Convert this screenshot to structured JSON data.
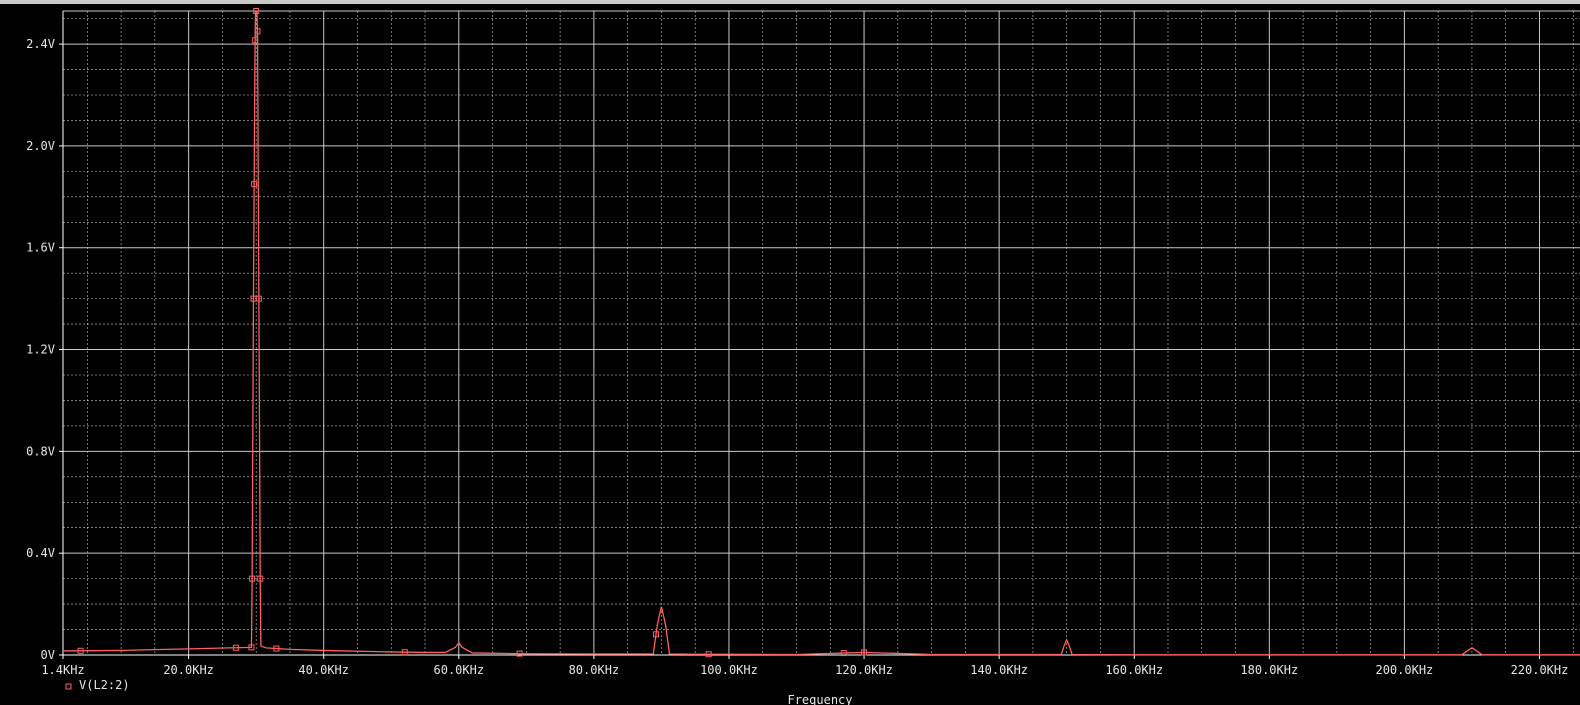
{
  "chart_data": {
    "type": "line",
    "title": "",
    "xlabel": "Frequency",
    "ylabel": "",
    "xlim": [
      1.4,
      226.0
    ],
    "ylim": [
      0,
      2.53
    ],
    "x_unit": "KHz",
    "grid": true,
    "grid_minor": true,
    "x_ticks": [
      1.4,
      20,
      40,
      60,
      80,
      100,
      120,
      140,
      160,
      180,
      200,
      220
    ],
    "x_tick_labels": [
      "1.4KHz",
      "20.0KHz",
      "40.0KHz",
      "60.0KHz",
      "80.0KHz",
      "100.0KHz",
      "120.0KHz",
      "140.0KHz",
      "160.0KHz",
      "180.0KHz",
      "200.0KHz",
      "220.0KHz"
    ],
    "y_ticks": [
      0,
      0.4,
      0.8,
      1.2,
      1.6,
      2.0,
      2.4
    ],
    "y_tick_labels": [
      "0V",
      "0.4V",
      "0.8V",
      "1.2V",
      "1.6V",
      "2.0V",
      "2.4V"
    ],
    "legend": {
      "placement": "bottom-left"
    },
    "series": [
      {
        "name": "V(L2:2)",
        "color": "#ff6060",
        "marker": "square",
        "x": [
          1.4,
          10,
          20,
          26,
          29.3,
          29.4,
          29.6,
          29.8,
          29.9,
          30.0,
          30.1,
          30.2,
          30.4,
          30.6,
          30.7,
          31.5,
          35,
          40,
          50,
          55,
          58,
          59.5,
          60,
          60.5,
          62,
          70,
          80,
          88.8,
          89.4,
          90,
          90.6,
          91.2,
          95,
          100,
          110,
          120,
          130,
          149.2,
          149.6,
          150,
          150.4,
          150.8,
          160,
          180,
          200,
          208.5,
          209.5,
          210,
          210.5,
          211.5,
          220,
          226
        ],
        "y": [
          0.016,
          0.018,
          0.024,
          0.028,
          0.03,
          0.3,
          1.4,
          2.3,
          2.53,
          2.53,
          2.53,
          2.45,
          1.4,
          0.3,
          0.035,
          0.028,
          0.022,
          0.018,
          0.012,
          0.01,
          0.01,
          0.03,
          0.048,
          0.03,
          0.008,
          0.005,
          0.004,
          0.004,
          0.12,
          0.19,
          0.12,
          0.004,
          0.003,
          0.003,
          0.002,
          0.01,
          0.002,
          0.002,
          0.035,
          0.06,
          0.035,
          0.002,
          0.001,
          0.001,
          0.001,
          0.001,
          0.02,
          0.028,
          0.02,
          0.001,
          0.001,
          0.001
        ]
      }
    ],
    "markers": {
      "x": [
        4,
        27,
        29.3,
        29.4,
        29.6,
        29.7,
        29.85,
        30.0,
        30.2,
        30.4,
        30.6,
        33,
        52,
        69,
        89.2,
        97,
        117,
        120
      ]
    }
  },
  "legend_label": "V(L2:2)",
  "colors": {
    "background": "#000000",
    "grid": "#c8c8c8",
    "axis": "#ffffff",
    "trace": "#ff6060",
    "text": "#e6e6e6"
  }
}
